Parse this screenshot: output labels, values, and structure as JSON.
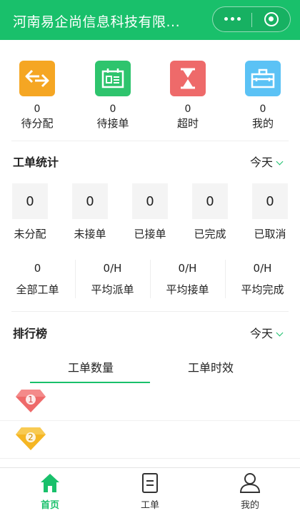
{
  "topbar": {
    "title": "河南易企尚信息科技有限..."
  },
  "tiles": [
    {
      "label": "待分配",
      "count": "0",
      "icon": "swap-arrows-icon",
      "color": "#f5a623"
    },
    {
      "label": "待接单",
      "count": "0",
      "icon": "calendar-board-icon",
      "color": "#2ec46d"
    },
    {
      "label": "超时",
      "count": "0",
      "icon": "hourglass-icon",
      "color": "#ee6a6a"
    },
    {
      "label": "我的",
      "count": "0",
      "icon": "toolbox-icon",
      "color": "#5bc2f5"
    }
  ],
  "stats_section": {
    "title": "工单统计",
    "filter": "今天",
    "items": [
      {
        "label": "未分配",
        "value": "0"
      },
      {
        "label": "未接单",
        "value": "0"
      },
      {
        "label": "已接单",
        "value": "0"
      },
      {
        "label": "已完成",
        "value": "0"
      },
      {
        "label": "已取消",
        "value": "0"
      }
    ],
    "averages": [
      {
        "label": "全部工单",
        "value": "0"
      },
      {
        "label": "平均派单",
        "value": "0/H"
      },
      {
        "label": "平均接单",
        "value": "0/H"
      },
      {
        "label": "平均完成",
        "value": "0/H"
      }
    ]
  },
  "ranking": {
    "title": "排行榜",
    "filter": "今天",
    "tabs": [
      {
        "label": "工单数量",
        "active": true
      },
      {
        "label": "工单时效",
        "active": false
      }
    ],
    "rows": [
      {
        "rank": "1",
        "color": "#ee6a6a"
      },
      {
        "rank": "2",
        "color": "#f5b623"
      }
    ]
  },
  "bottom_nav": [
    {
      "label": "首页",
      "active": true,
      "icon": "home-icon"
    },
    {
      "label": "工单",
      "active": false,
      "icon": "document-icon"
    },
    {
      "label": "我的",
      "active": false,
      "icon": "person-icon"
    }
  ],
  "colors": {
    "accent": "#19c06b",
    "text": "#222222",
    "muted": "#666666"
  }
}
